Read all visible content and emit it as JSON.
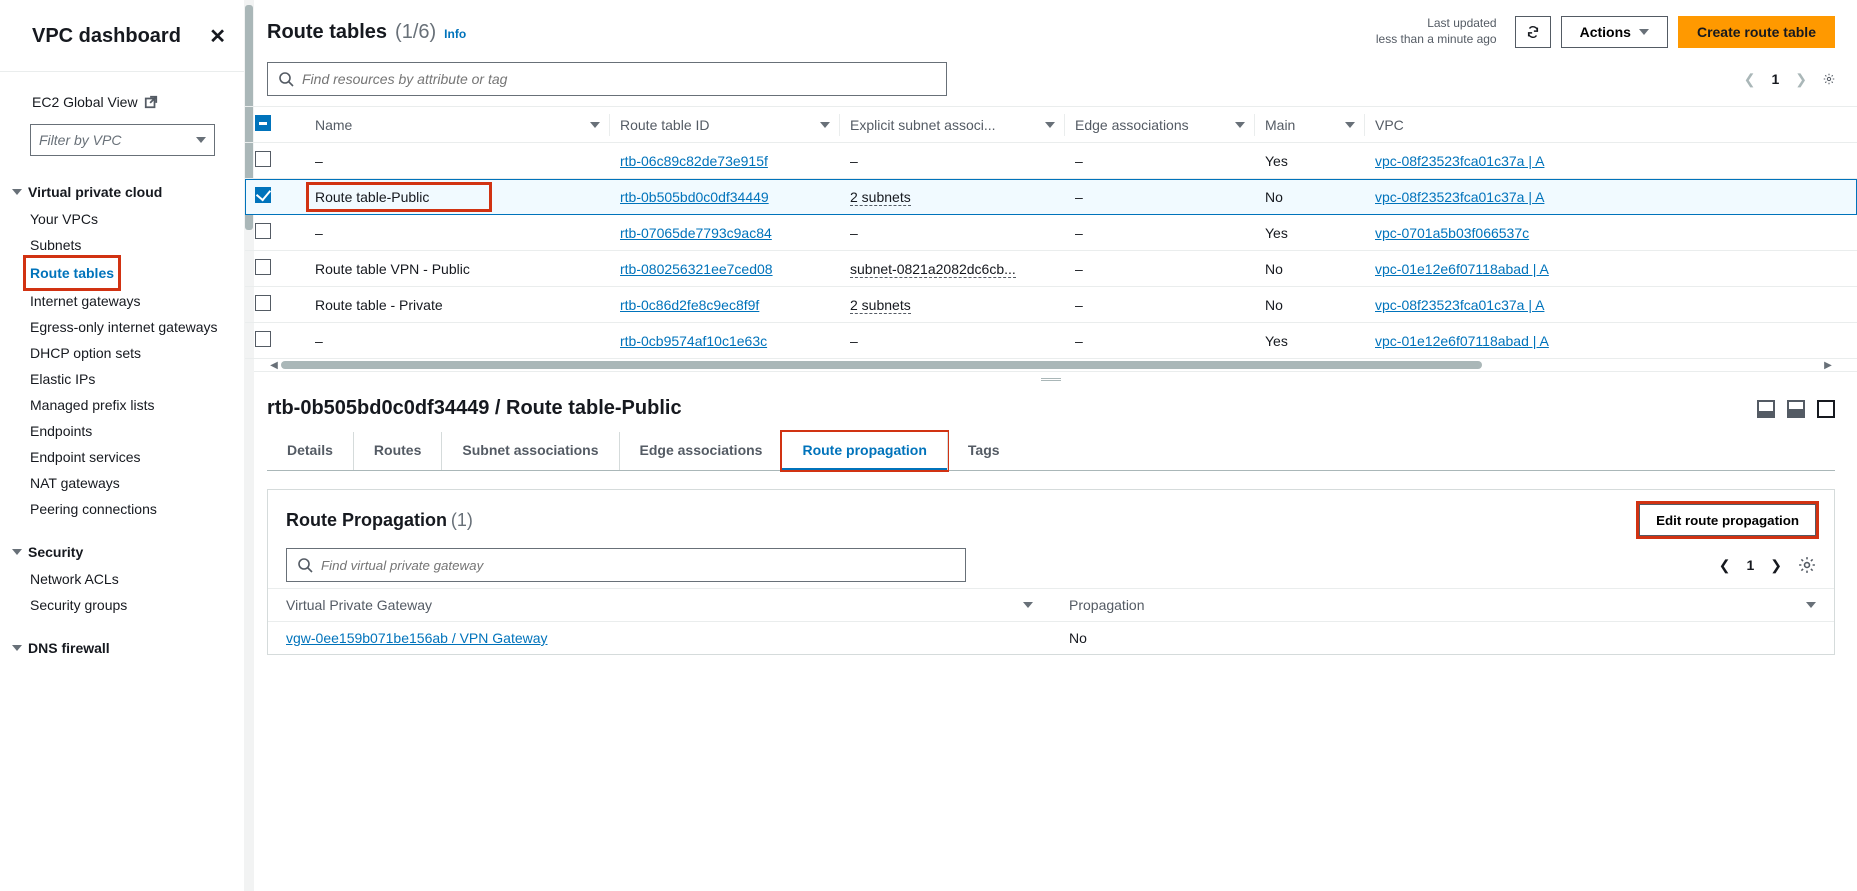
{
  "sidebar": {
    "title": "VPC dashboard",
    "ec2_label": "EC2 Global View",
    "filter_placeholder": "Filter by VPC",
    "groups": [
      {
        "title": "Virtual private cloud",
        "items": [
          {
            "label": "Your VPCs",
            "active": false
          },
          {
            "label": "Subnets",
            "active": false
          },
          {
            "label": "Route tables",
            "active": true
          },
          {
            "label": "Internet gateways",
            "active": false
          },
          {
            "label": "Egress-only internet gateways",
            "active": false
          },
          {
            "label": "DHCP option sets",
            "active": false
          },
          {
            "label": "Elastic IPs",
            "active": false
          },
          {
            "label": "Managed prefix lists",
            "active": false
          },
          {
            "label": "Endpoints",
            "active": false
          },
          {
            "label": "Endpoint services",
            "active": false
          },
          {
            "label": "NAT gateways",
            "active": false
          },
          {
            "label": "Peering connections",
            "active": false
          }
        ]
      },
      {
        "title": "Security",
        "items": [
          {
            "label": "Network ACLs",
            "active": false
          },
          {
            "label": "Security groups",
            "active": false
          }
        ]
      },
      {
        "title": "DNS firewall",
        "items": []
      }
    ]
  },
  "header": {
    "title": "Route tables",
    "count_text": "(1/6)",
    "info": "Info",
    "last_updated_l1": "Last updated",
    "last_updated_l2": "less than a minute ago",
    "actions_label": "Actions",
    "create_label": "Create route table"
  },
  "search": {
    "placeholder": "Find resources by attribute or tag",
    "page": "1"
  },
  "columns": {
    "name": "Name",
    "rtid": "Route table ID",
    "subnet": "Explicit subnet associ...",
    "edge": "Edge associations",
    "main": "Main",
    "vpc": "VPC"
  },
  "rows": [
    {
      "selected": false,
      "name": "–",
      "rt": "rtb-06c89c82de73e915f",
      "sub": "–",
      "sub_link": false,
      "edge": "–",
      "main": "Yes",
      "vpc": "vpc-08f23523fca01c37a | A"
    },
    {
      "selected": true,
      "name": "Route table-Public",
      "rt": "rtb-0b505bd0c0df34449",
      "sub": "2 subnets",
      "sub_link": true,
      "edge": "–",
      "main": "No",
      "vpc": "vpc-08f23523fca01c37a | A"
    },
    {
      "selected": false,
      "name": "–",
      "rt": "rtb-07065de7793c9ac84",
      "sub": "–",
      "sub_link": false,
      "edge": "–",
      "main": "Yes",
      "vpc": "vpc-0701a5b03f066537c"
    },
    {
      "selected": false,
      "name": "Route table VPN - Public",
      "rt": "rtb-080256321ee7ced08",
      "sub": "subnet-0821a2082dc6cb...",
      "sub_link": true,
      "edge": "–",
      "main": "No",
      "vpc": "vpc-01e12e6f07118abad | A"
    },
    {
      "selected": false,
      "name": "Route table - Private",
      "rt": "rtb-0c86d2fe8c9ec8f9f",
      "sub": "2 subnets",
      "sub_link": true,
      "edge": "–",
      "main": "No",
      "vpc": "vpc-08f23523fca01c37a | A"
    },
    {
      "selected": false,
      "name": "–",
      "rt": "rtb-0cb9574af10c1e63c",
      "sub": "–",
      "sub_link": false,
      "edge": "–",
      "main": "Yes",
      "vpc": "vpc-01e12e6f07118abad | A"
    }
  ],
  "detail": {
    "title": "rtb-0b505bd0c0df34449 / Route table-Public",
    "tabs": [
      "Details",
      "Routes",
      "Subnet associations",
      "Edge associations",
      "Route propagation",
      "Tags"
    ],
    "active_tab": 4,
    "panel_title": "Route Propagation",
    "panel_count": "(1)",
    "edit_btn": "Edit route propagation",
    "search_placeholder": "Find virtual private gateway",
    "page": "1",
    "inner_cols": {
      "vpg": "Virtual Private Gateway",
      "prop": "Propagation"
    },
    "inner_row": {
      "vpg": "vgw-0ee159b071be156ab / VPN Gateway",
      "prop": "No"
    }
  }
}
